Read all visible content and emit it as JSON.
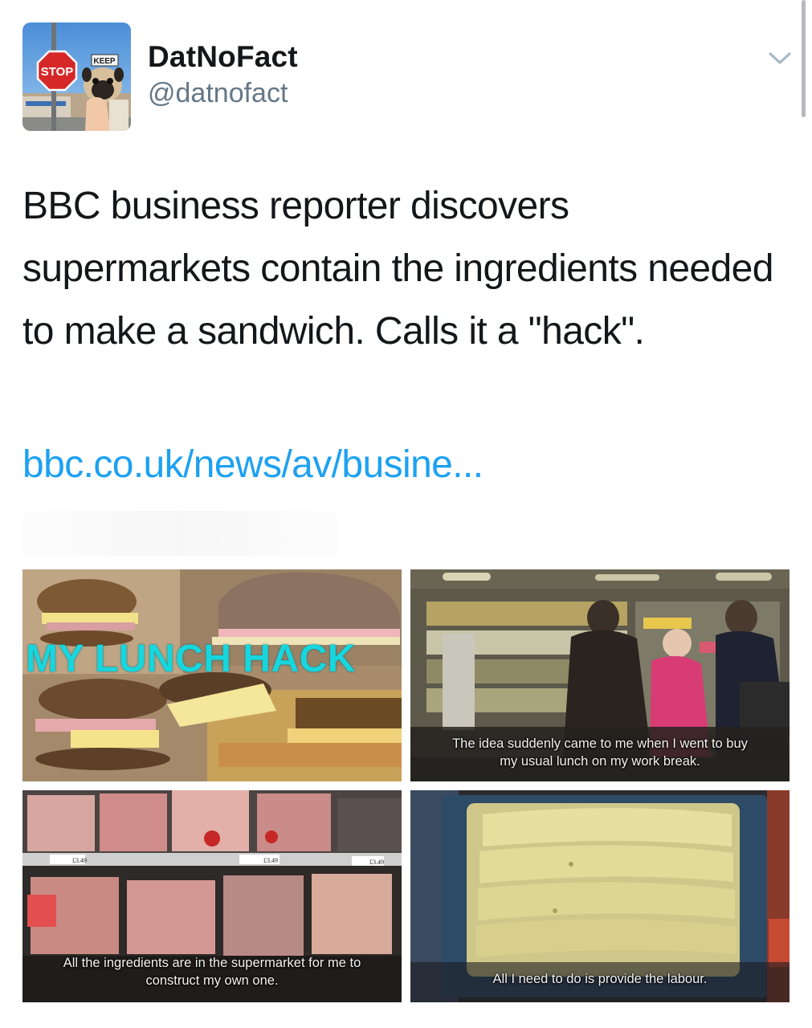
{
  "profile": {
    "display_name": "DatNoFact",
    "handle": "@datnofact",
    "avatar_sign_stop": "STOP",
    "avatar_sign_keep": "KEEP"
  },
  "tweet": {
    "text": "BBC business reporter discovers supermarkets contain the ingredients needed to make a sandwich. Calls it a \"hack\".",
    "link": "bbc.co.uk/news/av/busine..."
  },
  "media": [
    {
      "caption": "",
      "overlay_title": "MY LUNCH HACK"
    },
    {
      "caption": "The idea suddenly came to me when I went to buy\nmy usual lunch on my work break."
    },
    {
      "caption": "All the ingredients are in the supermarket for me to\nconstruct my own one."
    },
    {
      "caption": "All I need to do is provide the labour."
    }
  ],
  "price_tags": [
    "£3.49",
    "£3.49",
    "£3.49"
  ],
  "icons": {
    "menu": "chevron-down-icon"
  },
  "colors": {
    "link": "#1da1f2",
    "handle": "#657786",
    "text": "#14171a",
    "hack_title": "#17d6de"
  }
}
